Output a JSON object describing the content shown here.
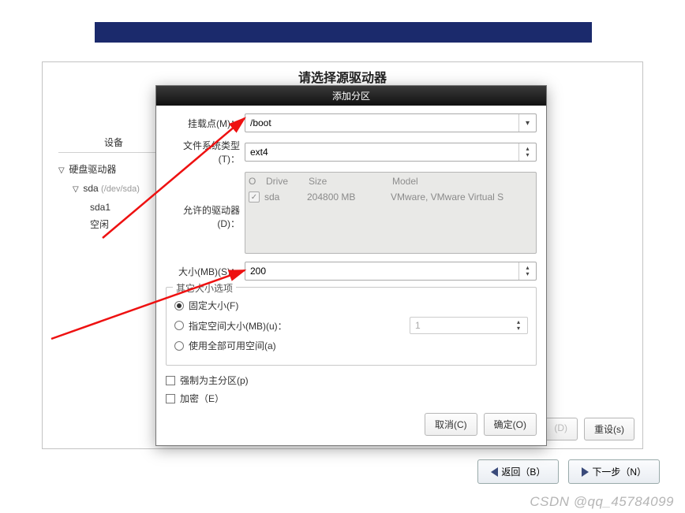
{
  "header_text_truncated": "请选择源驱动器",
  "blue_bar": true,
  "device_column_header": "设备",
  "tree": {
    "root": "硬盘驱动器",
    "sda_label": "sda",
    "sda_path": "(/dev/sda)",
    "children": [
      "sda1",
      "空闲"
    ]
  },
  "bottom_buttons": {
    "create_disabled": "(D)",
    "reset": "重设(s)"
  },
  "nav": {
    "back": "返回（B）",
    "next": "下一步（N）"
  },
  "dialog": {
    "title": "添加分区",
    "mount_label": "挂载点(M)：",
    "mount_value": "/boot",
    "fs_label": "文件系统类型(T)：",
    "fs_value": "ext4",
    "drives_label": "允许的驱动器(D)：",
    "drives_headers": {
      "col1": "O",
      "col2": "Drive",
      "col3": "Size",
      "col4": "Model"
    },
    "drives_row": {
      "name": "sda",
      "size": "204800 MB",
      "model": "VMware, VMware Virtual S"
    },
    "size_label": "大小(MB)(S)：",
    "size_value": "200",
    "other_size_legend": "其它大小选项",
    "radio_fixed": "固定大小(F)",
    "radio_fill_to": "指定空间大小(MB)(u)：",
    "radio_fill_to_value": "1",
    "radio_all": "使用全部可用空间(a)",
    "check_primary": "强制为主分区(p)",
    "check_encrypt": "加密（E）",
    "cancel": "取消(C)",
    "ok": "确定(O)"
  },
  "watermark": "CSDN @qq_45784099"
}
